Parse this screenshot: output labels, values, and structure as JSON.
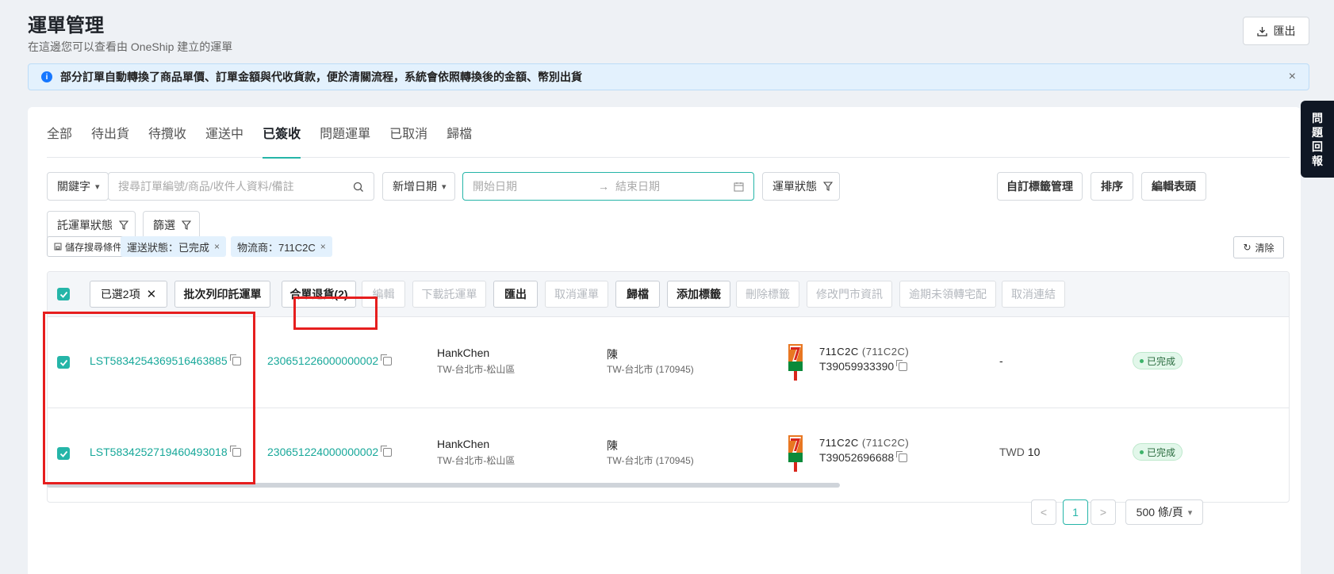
{
  "header": {
    "title": "運單管理",
    "subtitle": "在這邊您可以查看由 OneShip 建立的運單",
    "export_label": "匯出"
  },
  "notice": {
    "text": "部分訂單自動轉換了商品單價、訂單金額與代收貨款，便於清關流程，系統會依照轉換後的金額、幣別出貨"
  },
  "feedback": {
    "chars": [
      "問",
      "題",
      "回",
      "報"
    ]
  },
  "tabs": [
    {
      "label": "全部"
    },
    {
      "label": "待出貨"
    },
    {
      "label": "待攬收"
    },
    {
      "label": "運送中"
    },
    {
      "label": "已簽收"
    },
    {
      "label": "問題運單"
    },
    {
      "label": "已取消"
    },
    {
      "label": "歸檔"
    }
  ],
  "active_tab": "已簽收",
  "filters": {
    "keyword_label": "關鍵字",
    "search_placeholder": "搜尋訂單編號/商品/收件人資料/備註",
    "date_type_label": "新增日期",
    "start_date_placeholder": "開始日期",
    "end_date_placeholder": "結束日期",
    "shipment_status_label": "運單狀態",
    "custom_tags_label": "自訂標籤管理",
    "sort_label": "排序",
    "edit_header_label": "編輯表頭",
    "consignment_status_label": "託運單狀態",
    "filter_label": "篩選"
  },
  "chips": {
    "save_label": "儲存搜尋條件",
    "tags": [
      "運送狀態：已完成",
      "物流商：711C2C"
    ],
    "clear_label": "清除"
  },
  "bulk_actions": {
    "selected_label": "已選2項",
    "batch_print": "批次列印託運單",
    "merge_return": "合單退貨(2)",
    "edit": "編輯",
    "download": "下載託運單",
    "export": "匯出",
    "cancel": "取消運單",
    "archive": "歸檔",
    "add_tag": "添加標籤",
    "delete_tag": "刪除標籤",
    "modify_store": "修改門市資訊",
    "overdue": "逾期未領轉宅配",
    "unlink": "取消連結"
  },
  "rows": [
    {
      "shipment_no": "LST5834254369516463885",
      "order_no": "230651226000000002",
      "sender_name": "HankChen",
      "sender_region": "TW-台北市-松山區",
      "recipient_name": "陳",
      "recipient_region": "TW-台北市 (170945)",
      "carrier": "711C2C",
      "carrier_code": "(711C2C)",
      "tracking_no": "T39059933390",
      "cod": "-",
      "cod_amount": "",
      "status": "已完成"
    },
    {
      "shipment_no": "LST5834252719460493018",
      "order_no": "230651224000000002",
      "sender_name": "HankChen",
      "sender_region": "TW-台北市-松山區",
      "recipient_name": "陳",
      "recipient_region": "TW-台北市 (170945)",
      "carrier": "711C2C",
      "carrier_code": "(711C2C)",
      "tracking_no": "T39052696688",
      "cod": "TWD",
      "cod_amount": "10",
      "status": "已完成"
    }
  ],
  "pagination": {
    "prev": "<",
    "page": "1",
    "next": ">",
    "page_size": "500 條/頁"
  },
  "colors": {
    "accent": "#25b5a8",
    "highlight": "#e61e1e"
  }
}
